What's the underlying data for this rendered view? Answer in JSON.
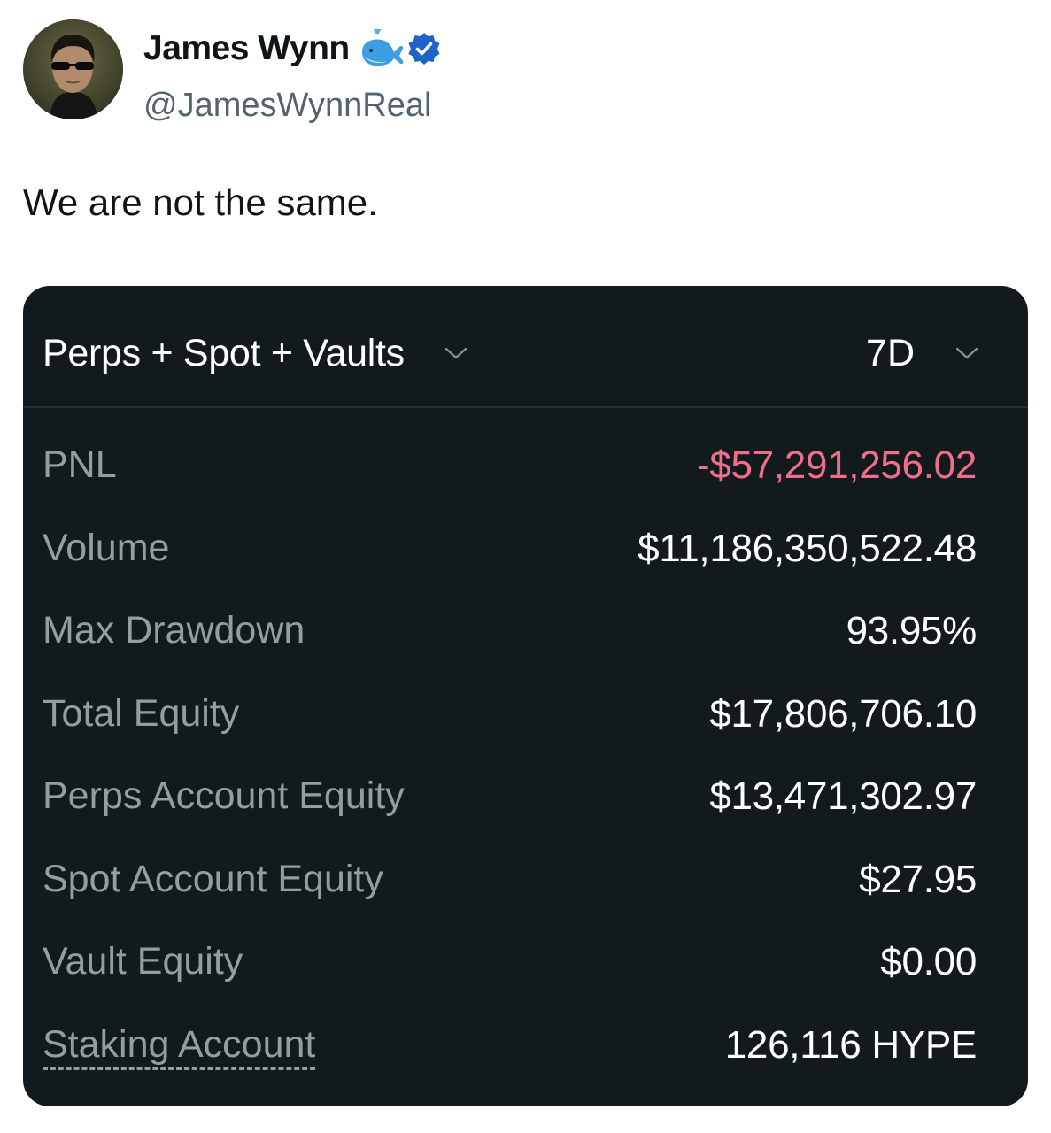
{
  "author": {
    "name": "James Wynn",
    "handle": "@JamesWynnReal",
    "icons": [
      "whale-icon",
      "verified-badge-icon"
    ]
  },
  "post": {
    "text": "We are not the same."
  },
  "card": {
    "filter_label": "Perps + Spot + Vaults",
    "period_label": "7D",
    "stats": [
      {
        "label": "PNL",
        "value": "-$57,291,256.02"
      },
      {
        "label": "Volume",
        "value": "$11,186,350,522.48"
      },
      {
        "label": "Max Drawdown",
        "value": "93.95%"
      },
      {
        "label": "Total Equity",
        "value": "$17,806,706.10"
      },
      {
        "label": "Perps Account Equity",
        "value": "$13,471,302.97"
      },
      {
        "label": "Spot Account Equity",
        "value": "$27.95"
      },
      {
        "label": "Vault Equity",
        "value": "$0.00"
      },
      {
        "label": "Staking Account",
        "value": "126,116 HYPE"
      }
    ]
  },
  "colors": {
    "card_background": "#121a1e",
    "negative_value": "#ed7088",
    "label_gray": "#949e9c",
    "verified_blue": "#1d9bf0"
  }
}
